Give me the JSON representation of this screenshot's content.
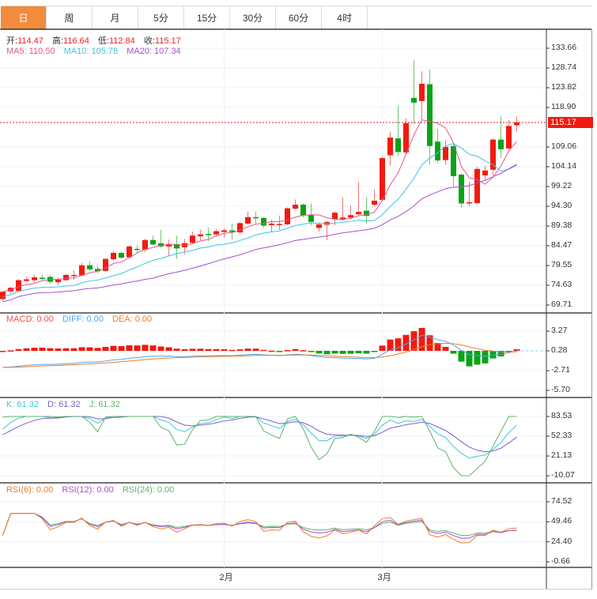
{
  "tabs": [
    "日",
    "周",
    "月",
    "5分",
    "15分",
    "30分",
    "60分",
    "4时"
  ],
  "active_tab": "日",
  "ohlc_legend": {
    "open_label": "开:",
    "open": "114.47",
    "high_label": "高:",
    "high": "116.64",
    "low_label": "低:",
    "low": "112.84",
    "close_label": "收:",
    "close": "115.17"
  },
  "ma_legend": {
    "ma5": "MA5: 110.50",
    "ma10": "MA10: 105.78",
    "ma20": "MA20: 107.34"
  },
  "macd_legend": {
    "macd": "MACD: 0.00",
    "diff": "DIFF: 0.00",
    "dea": "DEA: 0.00"
  },
  "kdj_legend": {
    "k": "K: 61.32",
    "d": "D: 61.32",
    "j": "J: 61.32"
  },
  "rsi_legend": {
    "rsi6": "RSI(6): 0.00",
    "rsi12": "RSI(12): 0.00",
    "rsi24": "RSI(24): 0.00"
  },
  "current_price": "115.17",
  "colors": {
    "up": "#f21a0e",
    "down": "#0aa414",
    "ma5": "#e8538f",
    "ma10": "#3ec6dc",
    "ma20": "#a64fd0",
    "diff": "#4ea5f0",
    "dea": "#f07c28",
    "k": "#3ec6dc",
    "d": "#7b5fc9",
    "j": "#5bb56a",
    "rsi6": "#f07c28",
    "rsi12": "#a64fd0",
    "rsi24": "#5bb56a",
    "accent": "#f28c3c"
  },
  "chart_data": {
    "type": "candlestick",
    "x_labels": [
      {
        "label": "2月",
        "index": 28
      },
      {
        "label": "3月",
        "index": 48
      }
    ],
    "price_axis": {
      "ticks": [
        "133.66",
        "128.74",
        "123.82",
        "118.90",
        "109.06",
        "104.14",
        "99.22",
        "94.30",
        "89.38",
        "84.47",
        "79.55",
        "74.63",
        "69.71"
      ],
      "range": [
        69.71,
        133.66
      ]
    },
    "macd_axis": {
      "ticks": [
        "3.27",
        "0.28",
        "-2.71",
        "-5.70"
      ],
      "range": [
        -5.7,
        3.27
      ]
    },
    "kdj_axis": {
      "ticks": [
        "83.53",
        "52.33",
        "21.13",
        "-10.07"
      ],
      "range": [
        -10.07,
        83.53
      ]
    },
    "rsi_axis": {
      "ticks": [
        "74.52",
        "49.46",
        "24.40",
        "-0.66"
      ],
      "range": [
        -0.66,
        74.52
      ]
    },
    "ohlc": [
      [
        71.2,
        73.2,
        70.8,
        73.0
      ],
      [
        73.1,
        74.2,
        72.6,
        74.0
      ],
      [
        73.2,
        76.2,
        72.9,
        75.9
      ],
      [
        75.7,
        76.7,
        75.5,
        76.1
      ],
      [
        75.9,
        77.2,
        75.4,
        76.6
      ],
      [
        76.5,
        77.2,
        75.9,
        76.3
      ],
      [
        76.7,
        77.2,
        75.0,
        75.5
      ],
      [
        75.4,
        76.5,
        74.6,
        76.0
      ],
      [
        75.9,
        77.5,
        75.7,
        77.2
      ],
      [
        77.0,
        78.3,
        76.0,
        77.2
      ],
      [
        77.1,
        80.2,
        76.9,
        79.6
      ],
      [
        79.6,
        80.6,
        78.2,
        78.6
      ],
      [
        78.7,
        79.4,
        77.6,
        78.1
      ],
      [
        78.2,
        81.4,
        78.0,
        81.2
      ],
      [
        81.1,
        83.2,
        80.8,
        82.7
      ],
      [
        82.7,
        83.0,
        81.2,
        81.5
      ],
      [
        81.6,
        84.5,
        81.4,
        84.3
      ],
      [
        83.7,
        84.6,
        82.5,
        83.6
      ],
      [
        83.5,
        86.2,
        82.9,
        85.9
      ],
      [
        85.9,
        87.0,
        84.5,
        84.8
      ],
      [
        85.1,
        88.4,
        84.0,
        84.3
      ],
      [
        84.3,
        86.0,
        81.8,
        84.9
      ],
      [
        84.9,
        87.0,
        81.2,
        83.8
      ],
      [
        84.1,
        86.2,
        82.3,
        85.1
      ],
      [
        85.2,
        88.0,
        85.0,
        87.0
      ],
      [
        86.8,
        88.5,
        85.8,
        87.3
      ],
      [
        87.4,
        89.0,
        85.6,
        87.1
      ],
      [
        87.3,
        88.6,
        86.8,
        88.1
      ],
      [
        87.9,
        88.8,
        86.5,
        88.3
      ],
      [
        88.3,
        90.0,
        86.0,
        87.9
      ],
      [
        87.8,
        90.4,
        87.5,
        90.1
      ],
      [
        90.0,
        93.0,
        89.8,
        91.6
      ],
      [
        91.6,
        93.0,
        90.0,
        91.3
      ],
      [
        91.4,
        91.6,
        89.0,
        89.5
      ],
      [
        89.6,
        91.0,
        88.0,
        90.0
      ],
      [
        89.7,
        92.0,
        88.4,
        89.9
      ],
      [
        89.8,
        94.0,
        89.6,
        93.8
      ],
      [
        93.7,
        96.0,
        93.5,
        94.7
      ],
      [
        94.7,
        95.0,
        91.5,
        92.0
      ],
      [
        92.2,
        95.0,
        89.6,
        90.4
      ],
      [
        88.9,
        90.2,
        88.0,
        89.8
      ],
      [
        89.7,
        90.6,
        85.9,
        90.4
      ],
      [
        91.1,
        93.0,
        89.6,
        92.7
      ],
      [
        91.1,
        96.5,
        90.8,
        91.5
      ],
      [
        91.5,
        94.4,
        91.0,
        92.1
      ],
      [
        92.3,
        100.3,
        91.8,
        92.9
      ],
      [
        93.2,
        96.5,
        90.0,
        91.9
      ],
      [
        94.7,
        98.6,
        94.4,
        95.7
      ],
      [
        95.9,
        106.6,
        95.5,
        106.3
      ],
      [
        107.0,
        112.9,
        104.4,
        111.4
      ],
      [
        111.2,
        119.4,
        106.8,
        107.8
      ],
      [
        107.7,
        116.2,
        107.3,
        115.0
      ],
      [
        121.3,
        130.7,
        114.7,
        120.1
      ],
      [
        120.5,
        127.9,
        116.0,
        124.8
      ],
      [
        124.7,
        128.3,
        104.7,
        109.3
      ],
      [
        110.4,
        113.6,
        105.0,
        105.7
      ],
      [
        105.8,
        110.8,
        104.6,
        109.1
      ],
      [
        109.3,
        109.6,
        99.2,
        101.8
      ],
      [
        102.2,
        102.4,
        94.0,
        95.0
      ],
      [
        95.0,
        100.4,
        94.3,
        95.3
      ],
      [
        95.1,
        104.2,
        94.8,
        103.6
      ],
      [
        102.0,
        104.4,
        100.6,
        103.2
      ],
      [
        103.4,
        111.2,
        102.0,
        110.9
      ],
      [
        110.9,
        116.7,
        106.3,
        108.5
      ],
      [
        108.7,
        115.8,
        108.4,
        114.3
      ],
      [
        114.47,
        116.64,
        112.84,
        115.17
      ]
    ]
  }
}
